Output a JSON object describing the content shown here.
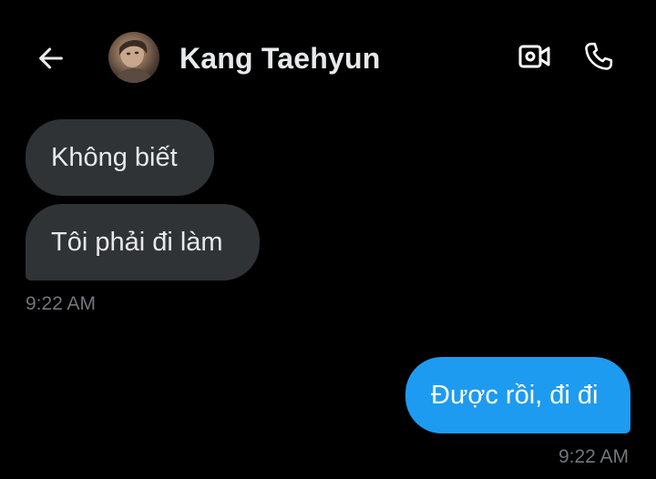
{
  "header": {
    "contact_name": "Kang Taehyun",
    "back_icon": "back-arrow-icon",
    "video_icon": "video-camera-icon",
    "call_icon": "phone-icon"
  },
  "conversation": {
    "received_messages": [
      {
        "text": "Không biết"
      },
      {
        "text": "Tôi phải đi làm"
      }
    ],
    "received_timestamp": "9:22 AM",
    "sent_messages": [
      {
        "text": "Được rồi, đi đi"
      }
    ],
    "sent_timestamp": "9:22 AM"
  },
  "colors": {
    "background": "#000000",
    "received_bubble": "#2f3336",
    "sent_bubble": "#1d9bf0",
    "timestamp_text": "#71767b"
  }
}
